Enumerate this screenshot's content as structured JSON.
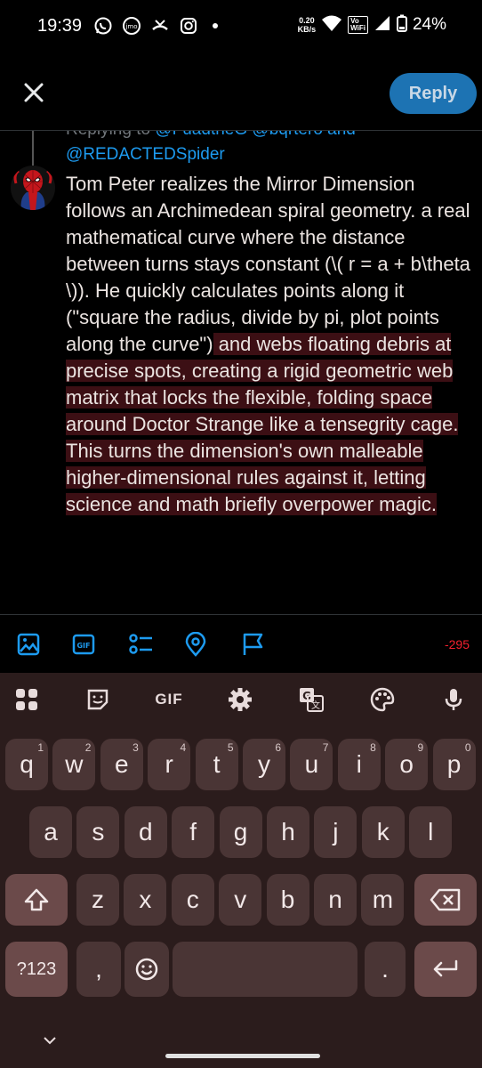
{
  "status_bar": {
    "time": "19:39",
    "net_speed_value": "0.20",
    "net_speed_unit": "KB/s",
    "vowifi": "Vo\nWiFi",
    "battery": "24%"
  },
  "header": {
    "reply_label": "Reply"
  },
  "compose": {
    "replying_prefix": "Replying to ",
    "replying_handles": "@FuadtheG @bqrtero and",
    "replying_handle_2": "@REDACTEDSpider",
    "text_normal": "Tom Peter realizes the Mirror Dimension follows an Archimedean spiral geometry. a real mathematical curve where the distance between turns stays constant (\\( r = a + b\\theta \\)). He quickly calculates points along it (\"square the radius, divide by pi, plot points along the curve\")",
    "text_over": " and webs floating debris at precise spots, creating a rigid geometric web matrix that locks the flexible, folding space around Doctor Strange like a tensegrity cage. This turns the dimension's own malleable higher-dimensional rules against it, letting science and math briefly overpower magic.",
    "char_count": "-295"
  },
  "keyboard": {
    "gif_label": "GIF",
    "row1": [
      {
        "key": "q",
        "hint": "1"
      },
      {
        "key": "w",
        "hint": "2"
      },
      {
        "key": "e",
        "hint": "3"
      },
      {
        "key": "r",
        "hint": "4"
      },
      {
        "key": "t",
        "hint": "5"
      },
      {
        "key": "y",
        "hint": "6"
      },
      {
        "key": "u",
        "hint": "7"
      },
      {
        "key": "i",
        "hint": "8"
      },
      {
        "key": "o",
        "hint": "9"
      },
      {
        "key": "p",
        "hint": "0"
      }
    ],
    "row2": [
      "a",
      "s",
      "d",
      "f",
      "g",
      "h",
      "j",
      "k",
      "l"
    ],
    "row3": [
      "z",
      "x",
      "c",
      "v",
      "b",
      "n",
      "m"
    ],
    "symbols_label": "?123",
    "comma": ",",
    "period": "."
  },
  "colors": {
    "accent": "#1d9bf0",
    "reply_button": "#1d73b3",
    "over_limit_highlight": "#3c0f14",
    "over_limit_count": "#f4212e",
    "keyboard_bg": "#2b1c1c",
    "key_bg": "#4a3535"
  }
}
